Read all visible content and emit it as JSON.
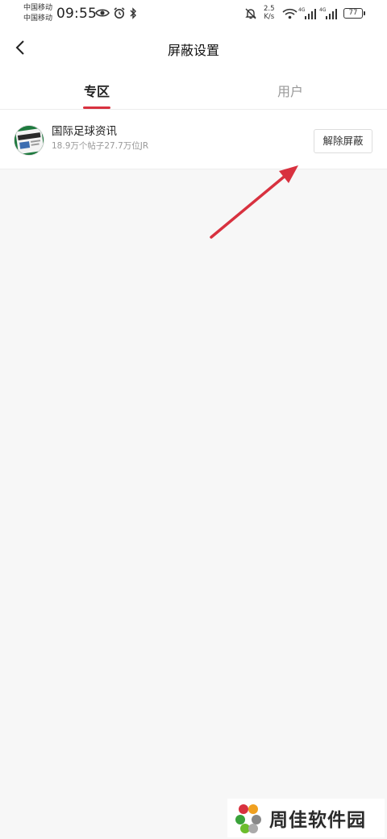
{
  "status_bar": {
    "carrier_1": "中国移动",
    "carrier_2": "中国移动",
    "time": "09:55",
    "speed_value": "2.5",
    "speed_unit": "K/s",
    "net_1": "4G",
    "net_2": "4G",
    "battery": "77"
  },
  "nav": {
    "title": "屏蔽设置"
  },
  "tabs": [
    {
      "label": "专区",
      "active": true
    },
    {
      "label": "用户",
      "active": false
    }
  ],
  "blocked_items": [
    {
      "name": "国际足球资讯",
      "meta": "18.9万个帖子27.7万位JR",
      "action": "解除屏蔽"
    }
  ],
  "annotation": {
    "color": "#d8313f"
  },
  "watermark": {
    "text": "周佳软件园"
  }
}
